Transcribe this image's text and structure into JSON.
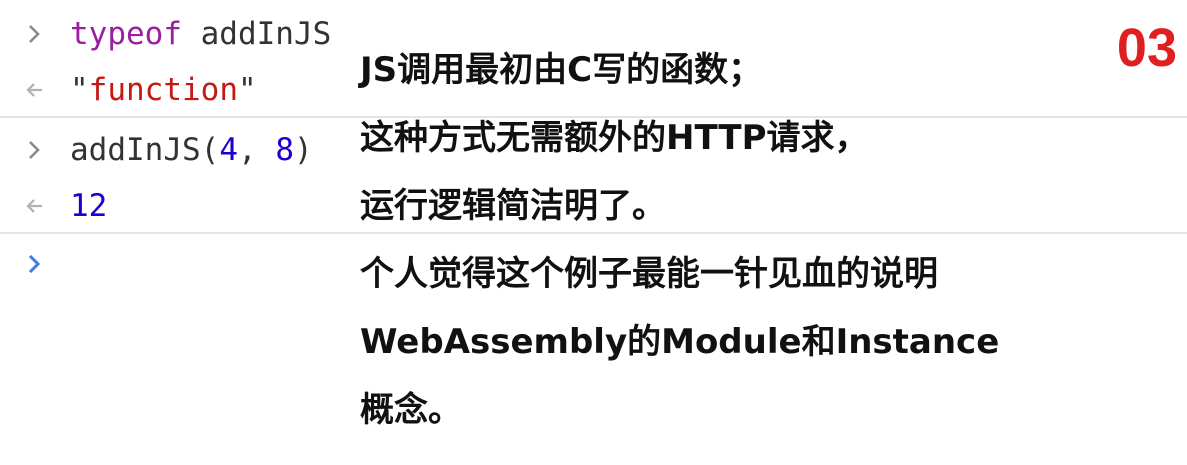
{
  "console": {
    "entries": [
      {
        "kind": "input",
        "tokens": [
          {
            "t": "typeof",
            "c": "kw"
          },
          {
            "t": " addInJS",
            "c": "punc"
          }
        ]
      },
      {
        "kind": "output",
        "tokens": [
          {
            "t": "\"",
            "c": "punc"
          },
          {
            "t": "function",
            "c": "str"
          },
          {
            "t": "\"",
            "c": "punc"
          }
        ]
      },
      {
        "kind": "input",
        "tokens": [
          {
            "t": "addInJS(",
            "c": "punc"
          },
          {
            "t": "4",
            "c": "num"
          },
          {
            "t": ", ",
            "c": "punc"
          },
          {
            "t": "8",
            "c": "num"
          },
          {
            "t": ")",
            "c": "punc"
          }
        ]
      },
      {
        "kind": "output",
        "tokens": [
          {
            "t": "12",
            "c": "num"
          }
        ]
      }
    ],
    "prompt_icon": "chevron-right-icon",
    "result_icon": "chevron-left-arrow-icon",
    "active_prompt_color": "#3d7ae6"
  },
  "annotation": {
    "lines": [
      "JS调用最初由C写的函数；",
      "这种方式无需额外的HTTP请求，",
      "运行逻辑简洁明了。",
      "个人觉得这个例子最能一针见血的说明",
      "WebAssembly的Module和Instance",
      "概念。"
    ],
    "badge": "03"
  }
}
